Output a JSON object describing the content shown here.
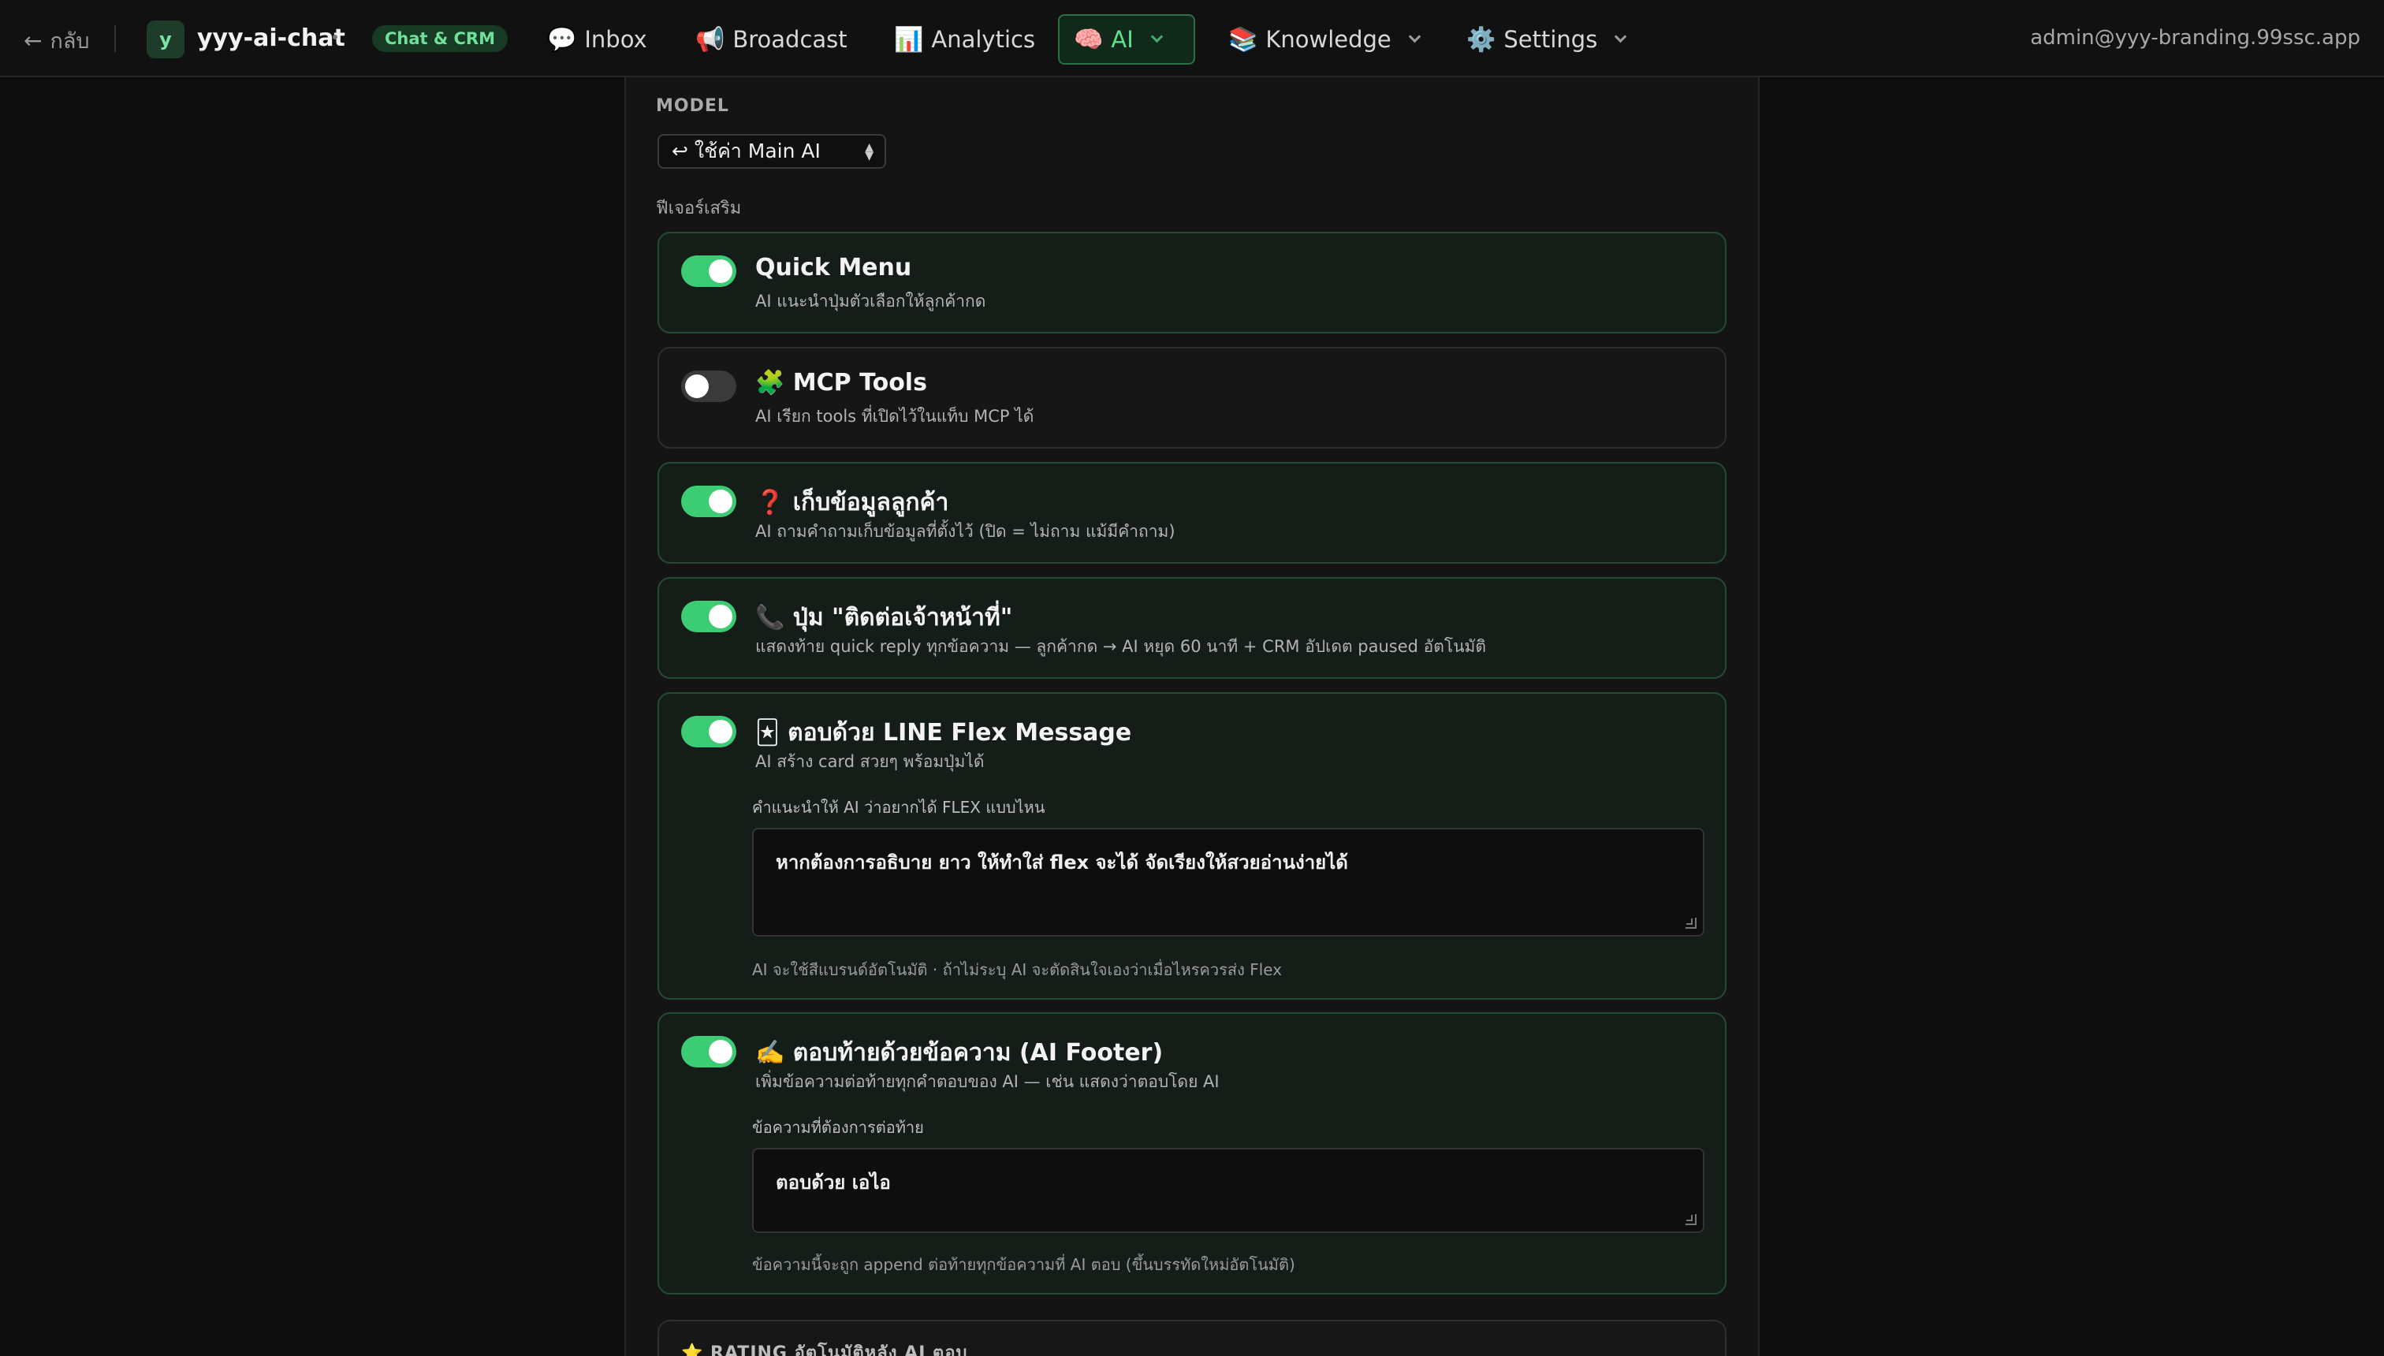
{
  "topbar": {
    "back_label": "กลับ",
    "workspace_initial": "y",
    "workspace_name": "yyy-ai-chat",
    "badge": "Chat & CRM",
    "nav": [
      {
        "icon": "💬",
        "label": "Inbox"
      },
      {
        "icon": "📢",
        "label": "Broadcast"
      },
      {
        "icon": "📊",
        "label": "Analytics"
      },
      {
        "icon": "🧠",
        "label": "AI"
      },
      {
        "icon": "📚",
        "label": "Knowledge"
      },
      {
        "icon": "⚙️",
        "label": "Settings"
      }
    ],
    "active_nav": "AI",
    "user_email": "admin@yyy-branding.99ssc.app"
  },
  "model": {
    "section_label": "MODEL",
    "selected": "↩ ใช้ค่า Main AI"
  },
  "features": {
    "section_label": "ฟีเจอร์เสริม",
    "items": [
      {
        "enabled": true,
        "title": "Quick Menu",
        "desc": "AI แนะนำปุ่มตัวเลือกให้ลูกค้ากด"
      },
      {
        "enabled": false,
        "title": "🧩 MCP Tools",
        "desc": "AI เรียก tools ที่เปิดไว้ในแท็บ MCP ได้"
      },
      {
        "enabled": true,
        "title": "❓ เก็บข้อมูลลูกค้า",
        "desc": "AI ถามคำถามเก็บข้อมูลที่ตั้งไว้ (ปิด = ไม่ถาม แม้มีคำถาม)"
      },
      {
        "enabled": true,
        "title": "📞 ปุ่ม \"ติดต่อเจ้าหน้าที่\"",
        "desc": "แสดงท้าย quick reply ทุกข้อความ — ลูกค้ากด → AI หยุด 60 นาที + CRM อัปเดต paused อัตโนมัติ"
      },
      {
        "enabled": true,
        "title": "🃏 ตอบด้วย LINE Flex Message",
        "desc": "AI สร้าง card สวยๆ พร้อมปุ่มได้",
        "field_label": "คำแนะนำให้ AI ว่าอยากได้ FLEX แบบไหน",
        "field_value": "หากต้องการอธิบาย ยาว ให้ทำใส่ flex จะได้ จัดเรียงให้สวยอ่านง่ายได้",
        "hint": "AI จะใช้สีแบรนด์อัตโนมัติ · ถ้าไม่ระบุ AI จะตัดสินใจเองว่าเมื่อไหรควรส่ง Flex"
      },
      {
        "enabled": true,
        "title": "✍️ ตอบท้ายด้วยข้อความ (AI Footer)",
        "desc": "เพิ่มข้อความต่อท้ายทุกคำตอบของ AI — เช่น แสดงว่าตอบโดย AI",
        "field_label": "ข้อความที่ต้องการต่อท้าย",
        "field_value": "ตอบด้วย เอไอ",
        "hint": "ข้อความนี้จะถูก append ต่อท้ายทุกข้อความที่ AI ตอบ (ขึ้นบรรทัดใหม่อัตโนมัติ)"
      }
    ]
  },
  "rating": {
    "title": "⭐ RATING อัตโนมัติหลัง AI ตอบ"
  },
  "colors": {
    "accent": "#3ccd74",
    "card_border_on": "#244a32",
    "background": "#0d0d0d"
  }
}
